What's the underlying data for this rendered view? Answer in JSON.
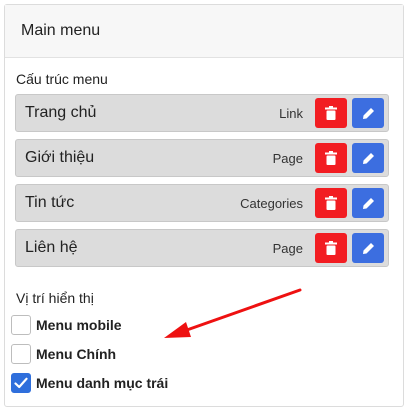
{
  "panel": {
    "title": "Main menu"
  },
  "structure": {
    "title": "Cấu trúc menu",
    "items": [
      {
        "name": "Trang chủ",
        "type": "Link"
      },
      {
        "name": "Giới thiệu",
        "type": "Page"
      },
      {
        "name": "Tin tức",
        "type": "Categories"
      },
      {
        "name": "Liên hệ",
        "type": "Page"
      }
    ]
  },
  "display": {
    "title": "Vị trí hiển thị",
    "options": [
      {
        "label": "Menu mobile",
        "checked": false
      },
      {
        "label": "Menu Chính",
        "checked": false
      },
      {
        "label": "Menu danh mục trái",
        "checked": true
      }
    ]
  },
  "colors": {
    "delete": "#f21d22",
    "edit": "#3c6ee0",
    "checked": "#2f6fdc",
    "arrow": "#ee1111"
  },
  "icons": {
    "delete": "trash-icon",
    "edit": "pencil-icon",
    "check": "check-icon",
    "annotation": "arrow-annotation"
  }
}
